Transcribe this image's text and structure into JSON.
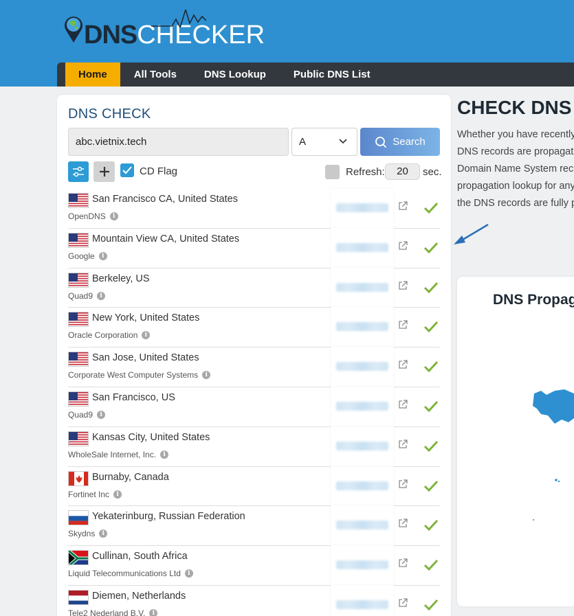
{
  "logo": {
    "part1": "DNS",
    "part2": "CHECKER"
  },
  "nav": {
    "items": [
      "Home",
      "All Tools",
      "DNS Lookup",
      "Public DNS List"
    ]
  },
  "dns_check": {
    "title": "DNS CHECK",
    "domain_value": "abc.vietnix.tech",
    "record_type": "A",
    "search_label": "Search",
    "cd_flag_label": "CD Flag",
    "refresh_label": "Refresh:",
    "refresh_value": "20",
    "refresh_unit": "sec."
  },
  "results": [
    {
      "flag": "us",
      "location": "San Francisco CA, United States",
      "provider": "OpenDNS"
    },
    {
      "flag": "us",
      "location": "Mountain View CA, United States",
      "provider": "Google"
    },
    {
      "flag": "us",
      "location": "Berkeley, US",
      "provider": "Quad9"
    },
    {
      "flag": "us",
      "location": "New York, United States",
      "provider": "Oracle Corporation"
    },
    {
      "flag": "us",
      "location": "San Jose, United States",
      "provider": "Corporate West Computer Systems"
    },
    {
      "flag": "us",
      "location": "San Francisco, US",
      "provider": "Quad9"
    },
    {
      "flag": "us",
      "location": "Kansas City, United States",
      "provider": "WholeSale Internet, Inc."
    },
    {
      "flag": "ca",
      "location": "Burnaby, Canada",
      "provider": "Fortinet Inc"
    },
    {
      "flag": "ru",
      "location": "Yekaterinburg, Russian Federation",
      "provider": "Skydns"
    },
    {
      "flag": "za",
      "location": "Cullinan, South Africa",
      "provider": "Liquid Telecommunications Ltd"
    },
    {
      "flag": "nl",
      "location": "Diemen, Netherlands",
      "provider": "Tele2 Nederland B.V."
    }
  ],
  "right": {
    "title": "CHECK DNS",
    "paragraph_lines": [
      "Whether you have recently",
      "DNS records are propagate",
      "Domain Name System reco",
      "propagation lookup for any",
      "the DNS records are fully p"
    ],
    "map_title": "DNS Propag"
  },
  "colors": {
    "header": "#2e90d0",
    "nav": "#33383e",
    "active_tab": "#f5ad00",
    "accent": "#2d9bd6",
    "check": "#7fb33a"
  }
}
